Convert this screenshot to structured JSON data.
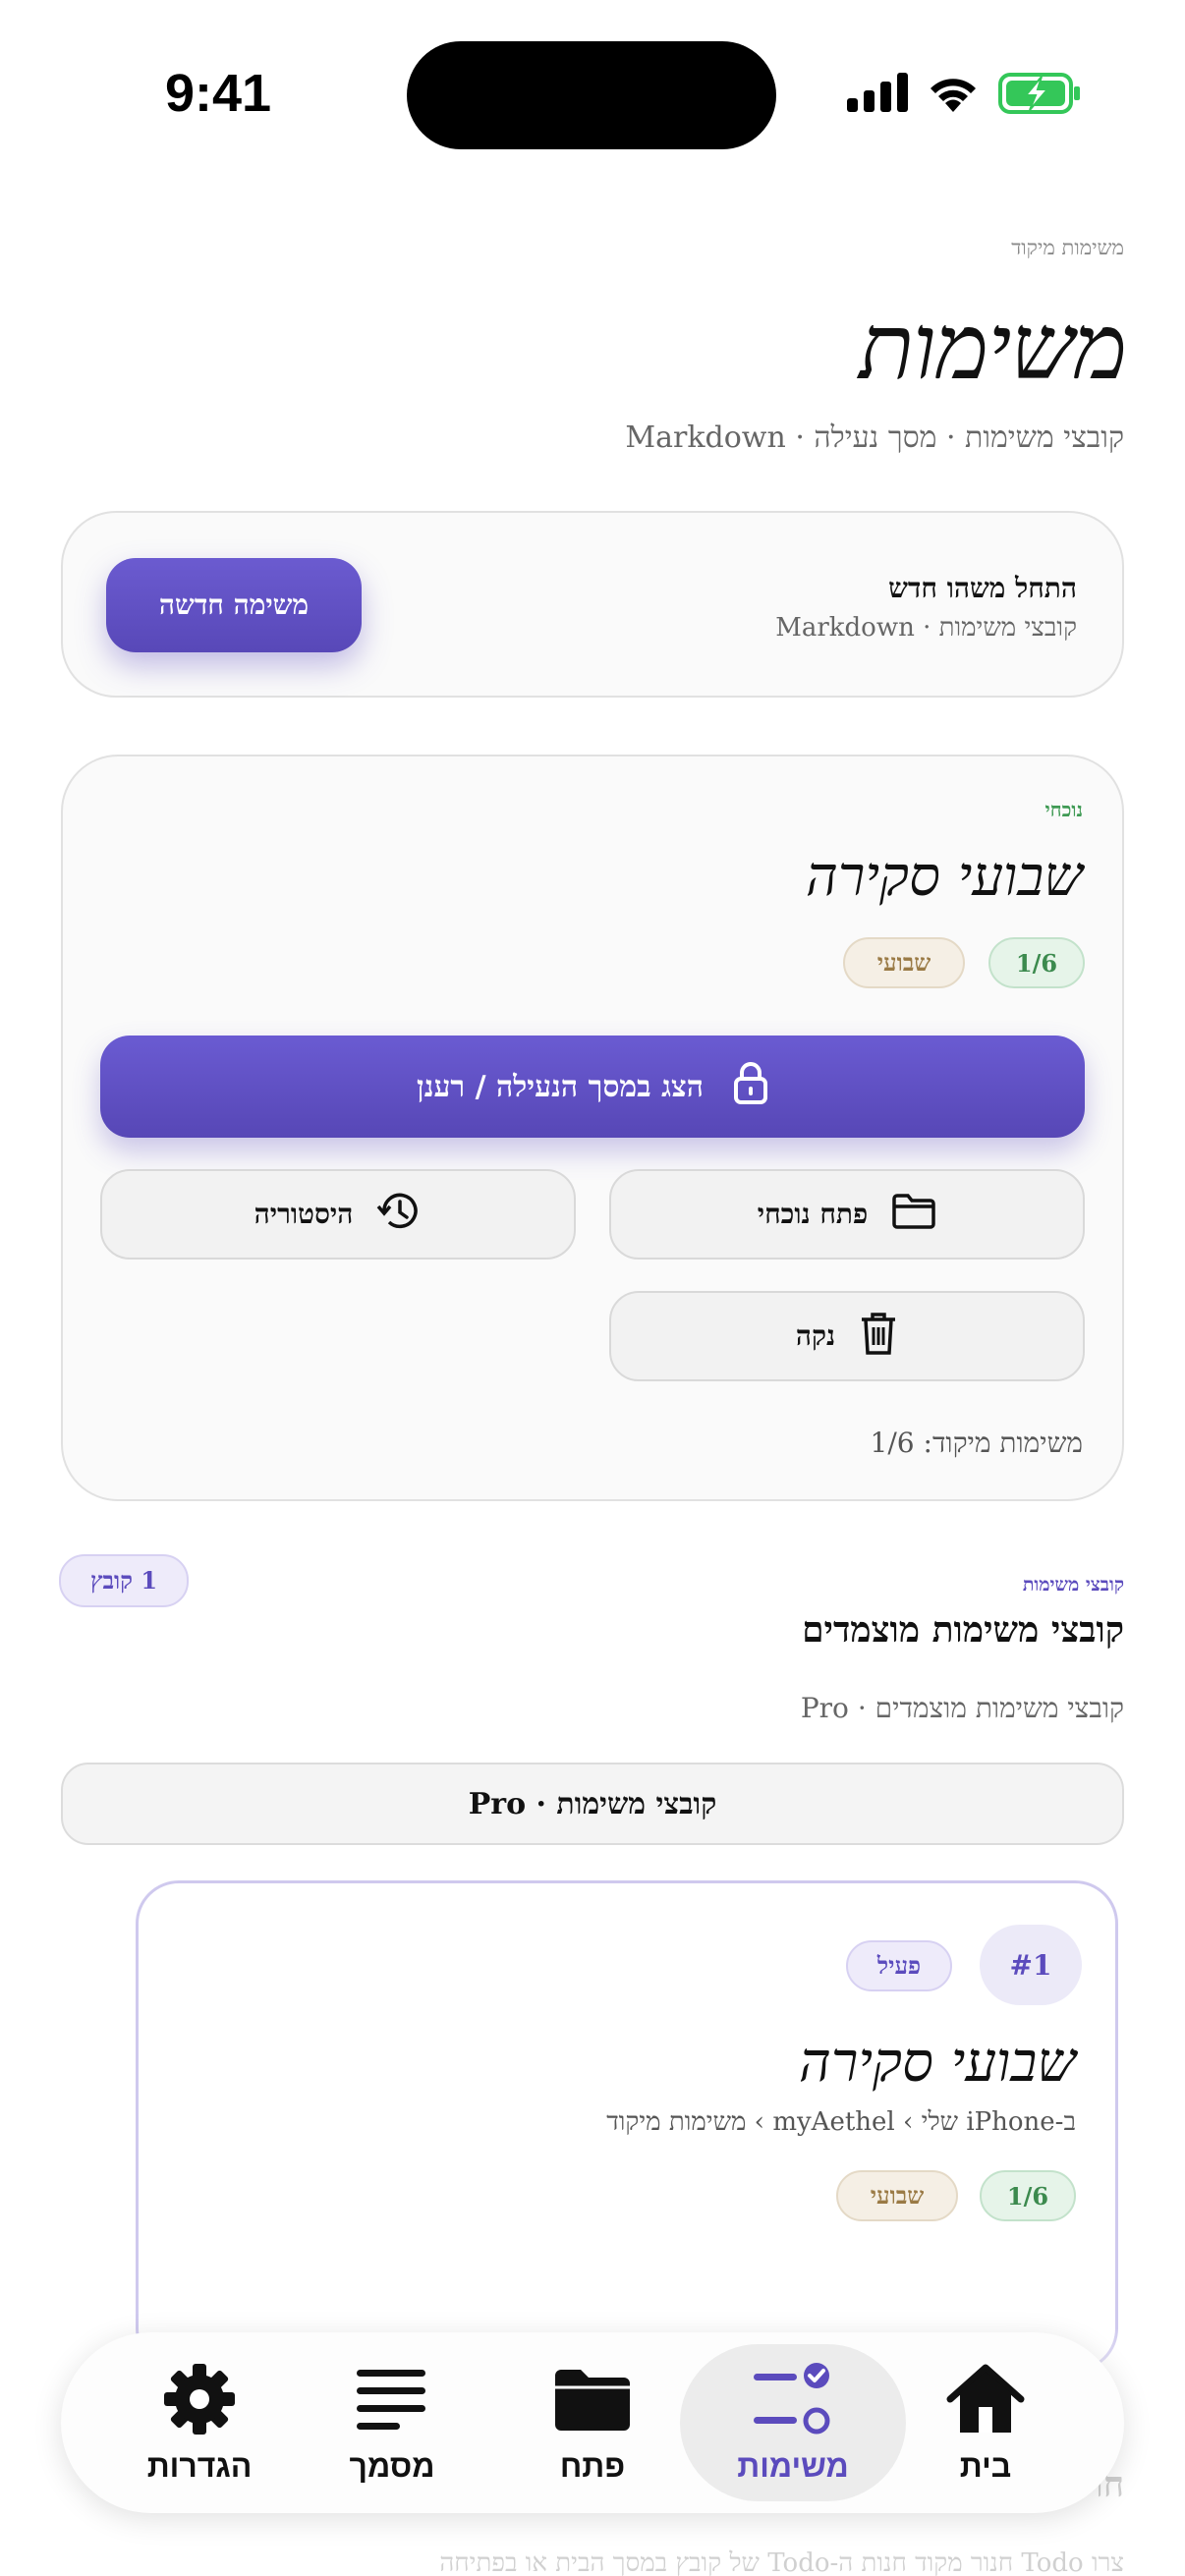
{
  "status_bar": {
    "time": "9:41"
  },
  "header": {
    "eyebrow": "משימות מיקוד",
    "title": "משימות",
    "subtitle": "קובצי משימות · מסך נעילה · Markdown"
  },
  "new_card": {
    "title": "התחל משהו חדש",
    "subtitle": "קובצי משימות · Markdown",
    "button": "משימה חדשה"
  },
  "current": {
    "eyebrow": "נוכחי",
    "title": "שבועי סקירה",
    "progress_badge": "1/6",
    "period_badge": "שבועי",
    "lock_button": "הצג במסך הנעילה / רענן",
    "open_button": "פתח נוכחי",
    "history_button": "היסטוריה",
    "clear_button": "נקה",
    "footer": "משימות מיקוד: 1/6"
  },
  "presets_section": {
    "eyebrow": "קובצי משימות",
    "title": "קובצי משימות מוצמדים",
    "subtitle": "קובצי משימות מוצמדים · Pro",
    "count": "1 קובץ",
    "wide_button": "קובצי משימות · Pro"
  },
  "preset_card": {
    "number": "#1",
    "status": "פעיל",
    "title": "שבועי סקירה",
    "path": "ב-iPhone שלי › myAethel › משימות מיקוד",
    "progress_badge": "1/6",
    "period_badge": "שבועי"
  },
  "peek": {
    "title": "חו",
    "text": "צרו Todo ‏חנור מקוד חנות ה-Todo של קובץ במסך הבית או בפתיחה"
  },
  "tab_bar": {
    "active": "tasks",
    "tabs": [
      {
        "id": "home",
        "label": "בית",
        "icon": "house-icon"
      },
      {
        "id": "tasks",
        "label": "משימות",
        "icon": "tasks-check-icon"
      },
      {
        "id": "open",
        "label": "פתח",
        "icon": "folder-icon"
      },
      {
        "id": "document",
        "label": "מסמך",
        "icon": "lines-icon"
      },
      {
        "id": "settings",
        "label": "הגדרות",
        "icon": "gear-icon"
      }
    ]
  },
  "colors": {
    "accent": "#5b4bbd",
    "success": "#3c8a4e",
    "battery": "#34c759"
  }
}
